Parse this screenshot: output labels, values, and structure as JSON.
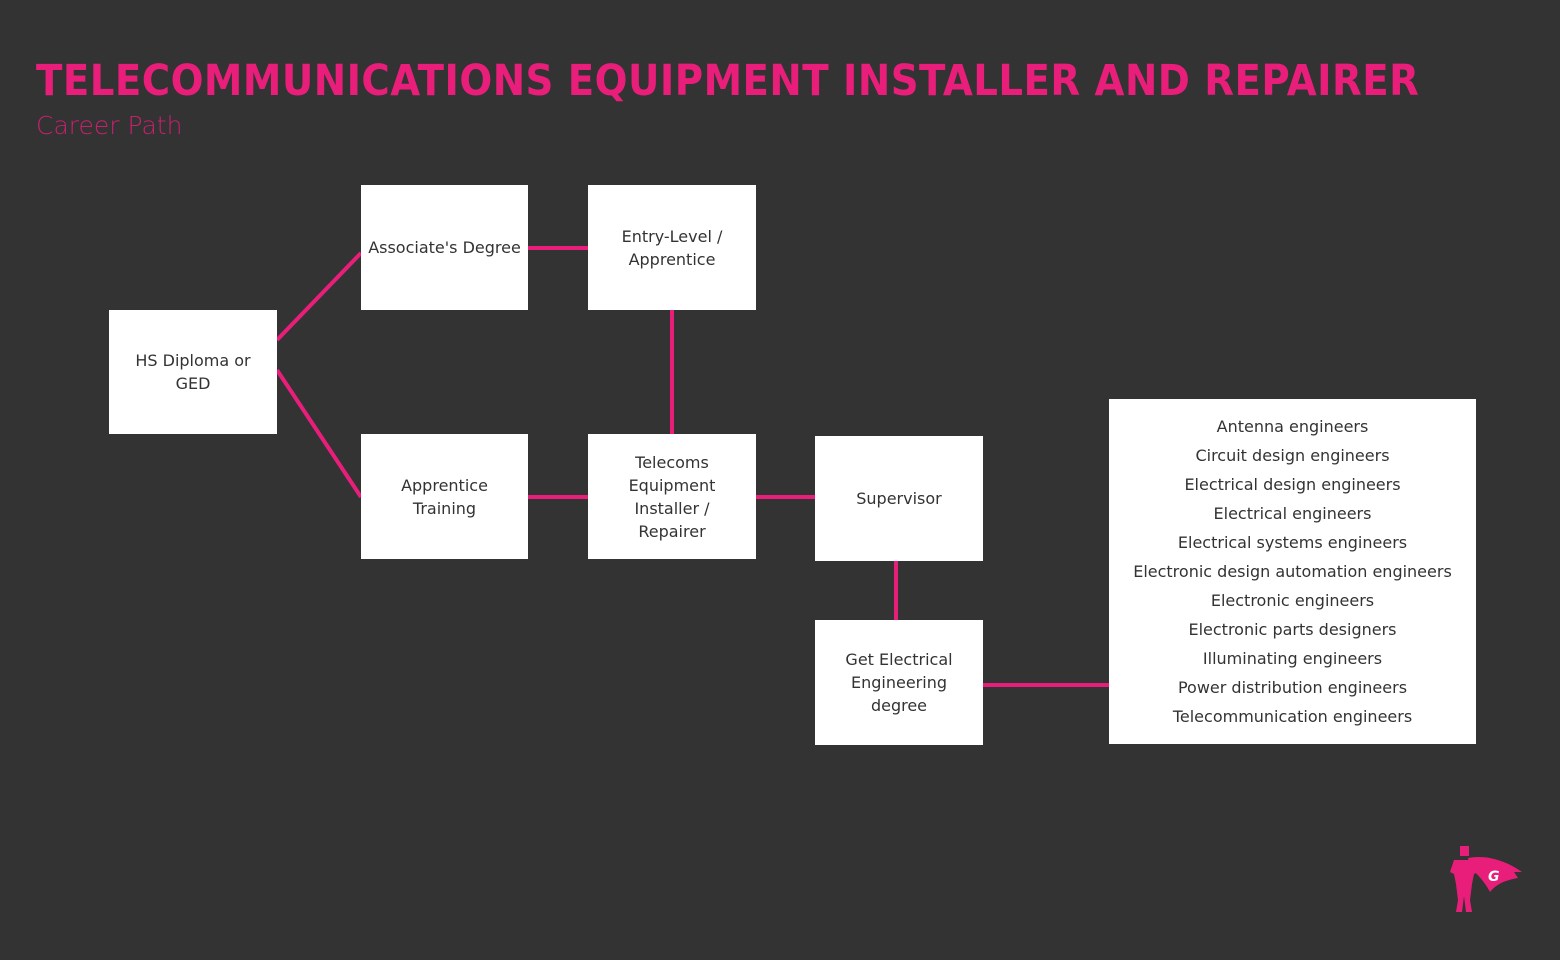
{
  "header": {
    "title": "TELECOMMUNICATIONS EQUIPMENT  INSTALLER AND REPAIRER",
    "subtitle": "Career Path"
  },
  "colors": {
    "background": "#333333",
    "accent": "#e91e7a",
    "node_fill": "#ffffff",
    "node_text": "#333333"
  },
  "nodes": {
    "hs_diploma": "HS Diploma or\nGED",
    "associates_degree": "Associate's Degree",
    "apprentice_training": "Apprentice\nTraining",
    "entry_level": "Entry-Level /\nApprentice",
    "telecoms_installer": "Telecoms\nEquipment\nInstaller /\nRepairer",
    "supervisor": "Supervisor",
    "ee_degree": "Get Electrical\nEngineering\ndegree"
  },
  "edges": [
    {
      "from": "hs_diploma",
      "to": "associates_degree"
    },
    {
      "from": "hs_diploma",
      "to": "apprentice_training"
    },
    {
      "from": "associates_degree",
      "to": "entry_level"
    },
    {
      "from": "entry_level",
      "to": "telecoms_installer"
    },
    {
      "from": "apprentice_training",
      "to": "telecoms_installer"
    },
    {
      "from": "telecoms_installer",
      "to": "supervisor"
    },
    {
      "from": "supervisor",
      "to": "ee_degree"
    },
    {
      "from": "ee_degree",
      "to": "engineering_outcomes"
    }
  ],
  "engineering_outcomes": [
    "Antenna engineers",
    "Circuit design engineers",
    "Electrical design engineers",
    "Electrical engineers",
    "Electrical systems engineers",
    "Electronic design automation engineers",
    "Electronic engineers",
    "Electronic parts designers",
    "Illuminating engineers",
    "Power distribution engineers",
    "Telecommunication engineers"
  ],
  "logo": {
    "icon": "superhero-icon",
    "letter": "G"
  }
}
